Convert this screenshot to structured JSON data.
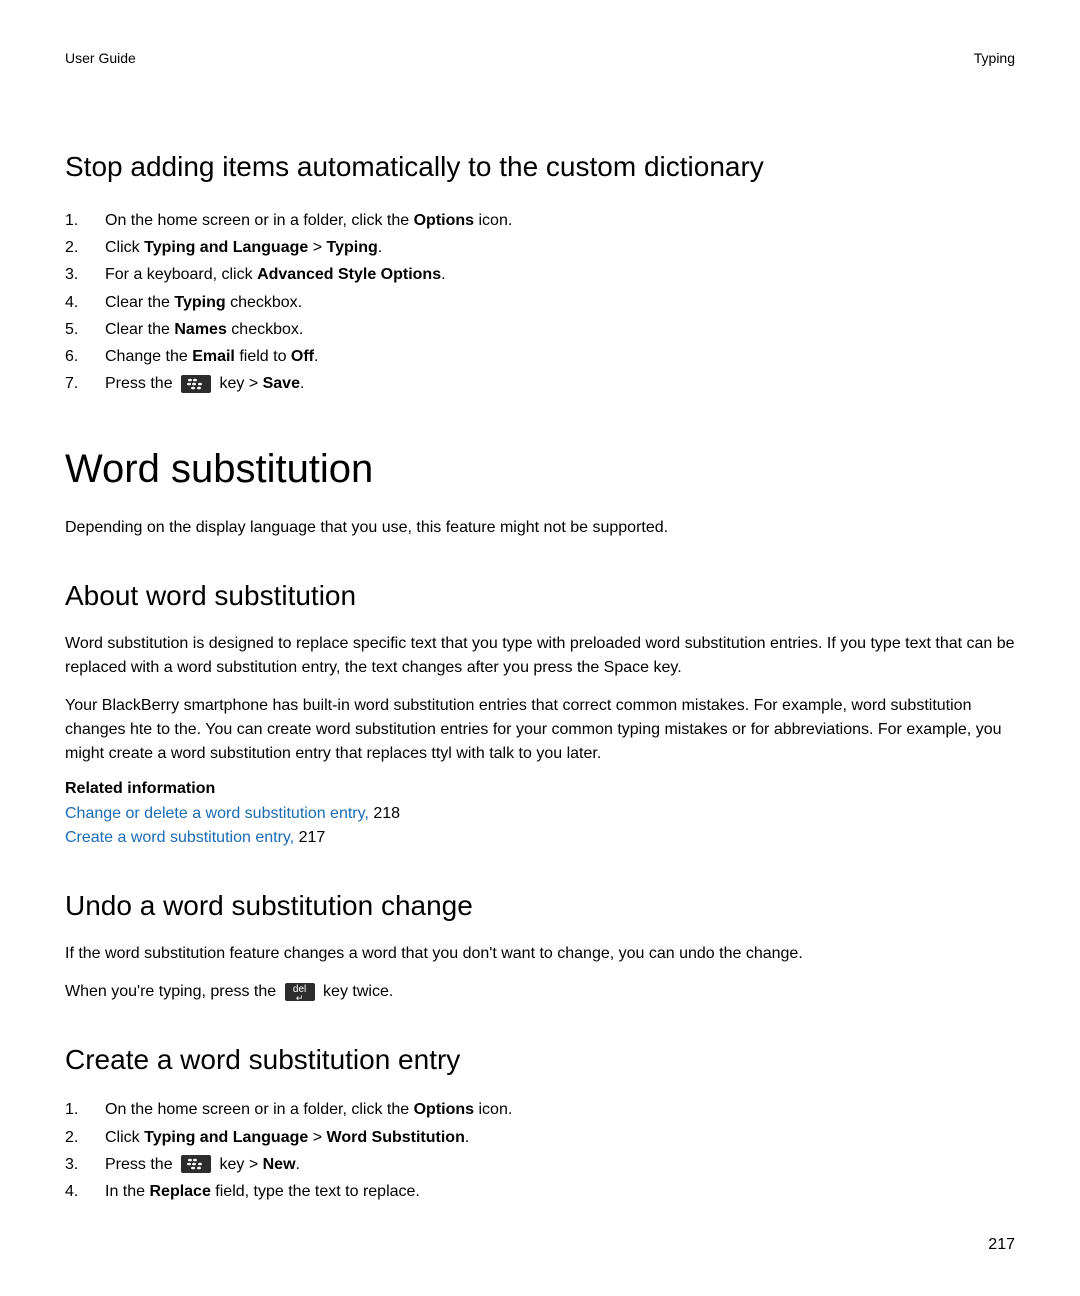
{
  "header": {
    "left": "User Guide",
    "right": "Typing"
  },
  "section1": {
    "title": "Stop adding items automatically to the custom dictionary",
    "steps": {
      "s1a": "On the home screen or in a folder, click the ",
      "s1b": "Options",
      "s1c": " icon.",
      "s2a": "Click ",
      "s2b": "Typing and Language",
      "s2c": " > ",
      "s2d": "Typing",
      "s2e": ".",
      "s3a": "For a keyboard, click ",
      "s3b": "Advanced Style Options",
      "s3c": ".",
      "s4a": "Clear the ",
      "s4b": "Typing",
      "s4c": " checkbox.",
      "s5a": "Clear the ",
      "s5b": "Names",
      "s5c": " checkbox.",
      "s6a": "Change the ",
      "s6b": "Email",
      "s6c": " field to ",
      "s6d": "Off",
      "s6e": ".",
      "s7a": "Press the ",
      "s7b": " key > ",
      "s7c": "Save",
      "s7d": "."
    }
  },
  "mainTitle": "Word substitution",
  "intro": "Depending on the display language that you use, this feature might not be supported.",
  "about": {
    "title": "About word substitution",
    "p1": "Word substitution is designed to replace specific text that you type with preloaded word substitution entries. If you type text that can be replaced with a word substitution entry, the text changes after you press the Space key.",
    "p2": "Your BlackBerry smartphone has built-in word substitution entries that correct common mistakes. For example, word substitution changes hte to the. You can create word substitution entries for your common typing mistakes or for abbreviations. For example, you might create a word substitution entry that replaces ttyl with talk to you later.",
    "relatedHeading": "Related information",
    "link1text": "Change or delete a word substitution entry,",
    "link1page": " 218",
    "link2text": "Create a word substitution entry,",
    "link2page": " 217"
  },
  "undo": {
    "title": "Undo a word substitution change",
    "p1": "If the word substitution feature changes a word that you don't want to change, you can undo the change.",
    "p2a": "When you're typing, press the ",
    "p2b": " key twice.",
    "delLabel": "del"
  },
  "create": {
    "title": "Create a word substitution entry",
    "steps": {
      "s1a": "On the home screen or in a folder, click the ",
      "s1b": "Options",
      "s1c": " icon.",
      "s2a": "Click ",
      "s2b": "Typing and Language",
      "s2c": " > ",
      "s2d": "Word Substitution",
      "s2e": ".",
      "s3a": "Press the ",
      "s3b": " key > ",
      "s3c": "New",
      "s3d": ".",
      "s4a": "In the ",
      "s4b": "Replace",
      "s4c": " field, type the text to replace."
    }
  },
  "pageNumber": "217"
}
